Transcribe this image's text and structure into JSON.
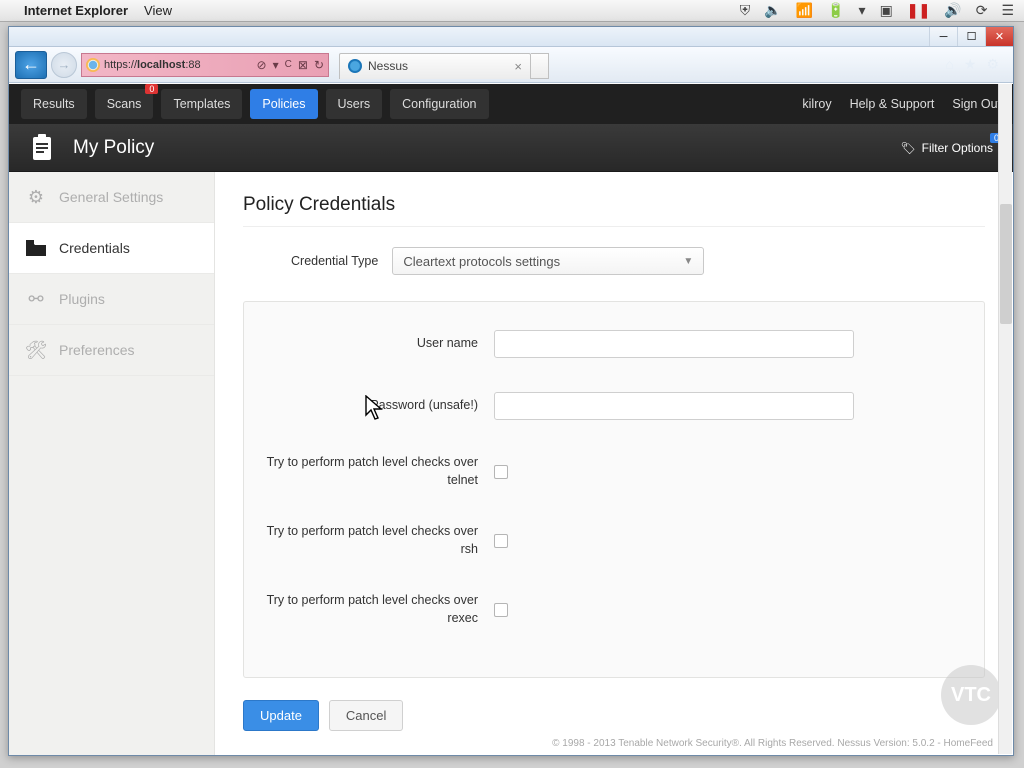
{
  "mac": {
    "app_name": "Internet Explorer",
    "menu_view": "View"
  },
  "ie": {
    "url_scheme": "https://",
    "url_host": "localhost",
    "url_rest": ":88",
    "tab_title": "Nessus"
  },
  "nav": {
    "results": "Results",
    "scans": "Scans",
    "scans_badge": "0",
    "templates": "Templates",
    "policies": "Policies",
    "users": "Users",
    "configuration": "Configuration",
    "user": "kilroy",
    "help": "Help & Support",
    "signout": "Sign Out"
  },
  "subhead": {
    "title": "My Policy",
    "filter": "Filter Options",
    "filter_badge": "0"
  },
  "sidebar": {
    "general": "General Settings",
    "credentials": "Credentials",
    "plugins": "Plugins",
    "preferences": "Preferences"
  },
  "content": {
    "heading": "Policy Credentials",
    "credential_type_label": "Credential Type",
    "credential_type_value": "Cleartext protocols settings",
    "username_label": "User name",
    "username_value": "",
    "password_label": "Password (unsafe!)",
    "password_value": "",
    "telnet_label": "Try to perform patch level checks over telnet",
    "rsh_label": "Try to perform patch level checks over rsh",
    "rexec_label": "Try to perform patch level checks over rexec",
    "update": "Update",
    "cancel": "Cancel"
  },
  "footer": "© 1998 - 2013 Tenable Network Security®. All Rights Reserved. Nessus Version: 5.0.2 - HomeFeed",
  "watermark": "VTC"
}
